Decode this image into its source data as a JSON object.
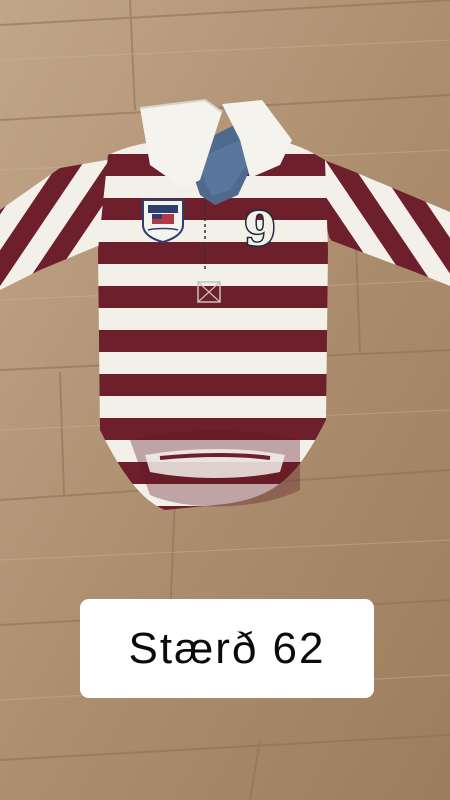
{
  "photo": {
    "subject": "striped-long-sleeve-baby-bodysuit",
    "colors": {
      "floor": "#b8987a",
      "floor_dark": "#8f7356",
      "stripe_maroon": "#6e1f2c",
      "stripe_white": "#f3f0ea",
      "denim": "#4f6a8d",
      "collar": "#f5f3ee"
    },
    "badge_number": "9"
  },
  "caption": {
    "text": "Stærð 62"
  }
}
